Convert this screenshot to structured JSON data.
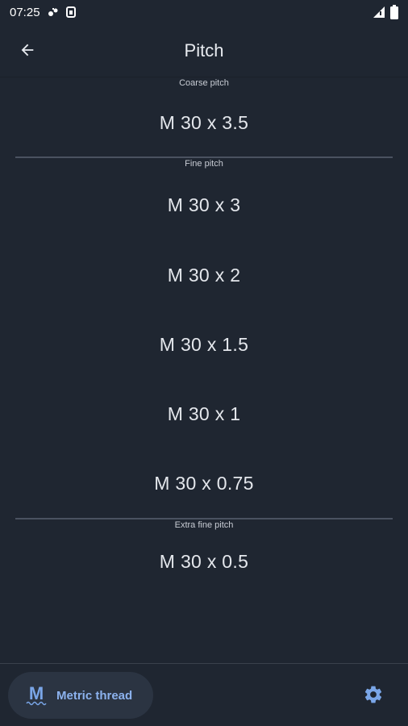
{
  "status_bar": {
    "time": "07:25",
    "icons": [
      "sync-icon",
      "sim-icon",
      "signal-icon",
      "battery-icon"
    ]
  },
  "app_bar": {
    "title": "Pitch",
    "back_icon": "arrow-left-icon"
  },
  "sections": {
    "coarse": {
      "label": "Coarse pitch",
      "items": [
        "M 30 x 3.5"
      ]
    },
    "fine": {
      "label": "Fine pitch",
      "items": [
        "M 30 x 3",
        "M 30 x 2",
        "M 30 x 1.5",
        "M 30 x 1",
        "M 30 x 0.75"
      ]
    },
    "extra_fine": {
      "label": "Extra fine pitch",
      "items": [
        "M 30 x 0.5"
      ]
    }
  },
  "bottom_nav": {
    "active_glyph": "M",
    "active_label": "Metric thread",
    "settings_icon": "gear-icon"
  },
  "colors": {
    "background": "#1f2631",
    "accent": "#8cb2ee",
    "divider": "#4a5260",
    "pill": "#2b3442"
  }
}
